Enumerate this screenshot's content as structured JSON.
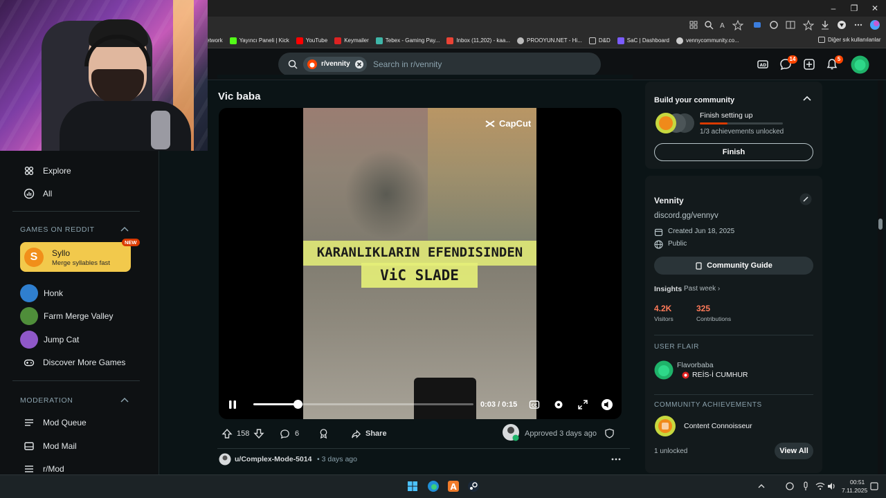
{
  "window": {
    "minimize": "–",
    "maximize": "❐",
    "close": "✕"
  },
  "bookmarks": [
    {
      "label": "etwork",
      "color": "#888888"
    },
    {
      "label": "Yayıncı Paneli | Kick",
      "color": "#53fc18"
    },
    {
      "label": "YouTube",
      "color": "#ff0000"
    },
    {
      "label": "Keymailer",
      "color": "#d22"
    },
    {
      "label": "Tebex - Gaming Pay...",
      "color": "#3fb6a8"
    },
    {
      "label": "Inbox (11,202) - kaa...",
      "color": "#ea4335"
    },
    {
      "label": "PROOYUN.NET - Hi...",
      "color": "#bbbbbb"
    },
    {
      "label": "D&D",
      "color": "#cccccc"
    },
    {
      "label": "SaC | Dashboard",
      "color": "#7b5cff"
    },
    {
      "label": "vennycommunity.co...",
      "color": "#cccccc"
    }
  ],
  "bookmarks_other": "Diğer sık kullanılanlar",
  "search": {
    "chip": "r/vennity",
    "placeholder": "Search in r/vennity"
  },
  "header": {
    "chat_badge": "14",
    "notif_badge": "5"
  },
  "leftnav": {
    "items": [
      {
        "label": "Explore",
        "icon": "explore-icon"
      },
      {
        "label": "All",
        "icon": "all-icon"
      }
    ],
    "games_title": "GAMES ON REDDIT",
    "featured_game": {
      "name": "Syllo",
      "desc": "Merge syllables fast",
      "badge": "NEW",
      "initial": "S"
    },
    "games": [
      {
        "label": "Honk",
        "color": "#2f7fcf"
      },
      {
        "label": "Farm Merge Valley",
        "color": "#4f8e3a"
      },
      {
        "label": "Jump Cat",
        "color": "#8f58c8"
      }
    ],
    "discover": "Discover More Games",
    "moderation_title": "MODERATION",
    "mod_items": [
      "Mod Queue",
      "Mod Mail",
      "r/Mod"
    ]
  },
  "post": {
    "title": "Vic baba",
    "video": {
      "watermark": "CapCut",
      "caption_line1": "KARANLIKLARIN EFENDISINDEN",
      "caption_line2": "ViC SLADE",
      "time": "0:03 / 0:15",
      "progress": 0.2
    },
    "votes": "158",
    "comments": "6",
    "share": "Share",
    "approved": "Approved 3 days ago"
  },
  "next_post": {
    "author": "u/Complex-Mode-5014",
    "time": "• 3 days ago"
  },
  "community_card": {
    "title": "Build your community",
    "task": "Finish setting up",
    "progress_text": "1/3 achievements unlocked",
    "progress": 0.333,
    "button": "Finish"
  },
  "about": {
    "name": "Vennity",
    "link": "discord.gg/vennyv",
    "created": "Created Jun 18, 2025",
    "visibility": "Public",
    "guide": "Community Guide",
    "insights": "Insights",
    "period": "Past week ›",
    "visitors_value": "4.2K",
    "visitors_label": "Visitors",
    "contrib_value": "325",
    "contrib_label": "Contributions"
  },
  "flair": {
    "title": "USER FLAIR",
    "user": "Flavorbaba",
    "tag": "REİS-İ CUMHUR"
  },
  "achievements": {
    "title": "COMMUNITY ACHIEVEMENTS",
    "name": "Content Connoisseur",
    "count": "1 unlocked",
    "button": "View All"
  },
  "taskbar": {
    "time": "00:51",
    "date": "7.11.2025"
  }
}
